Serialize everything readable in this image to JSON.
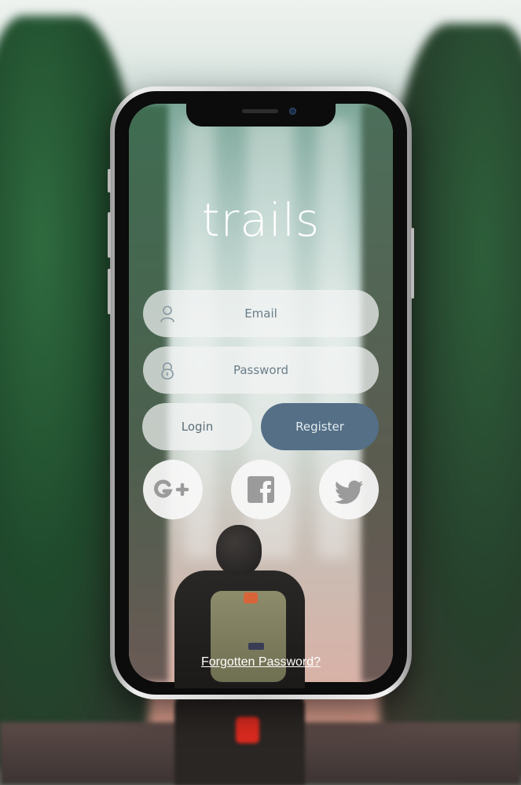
{
  "app": {
    "title": "trails"
  },
  "login_form": {
    "email_placeholder": "Email",
    "password_placeholder": "Password",
    "login_label": "Login",
    "register_label": "Register",
    "forgot_password_label": "Forgotten Password?"
  },
  "social_buttons": [
    {
      "name": "google-plus",
      "icon": "google-plus-icon"
    },
    {
      "name": "facebook",
      "icon": "facebook-icon"
    },
    {
      "name": "twitter",
      "icon": "twitter-icon"
    }
  ],
  "colors": {
    "primary_button": "#546f86",
    "input_background": "#f2f4f4",
    "placeholder_text": "#6a7d88",
    "social_icon": "#9b9b9b",
    "title_text": "#ffffff"
  }
}
